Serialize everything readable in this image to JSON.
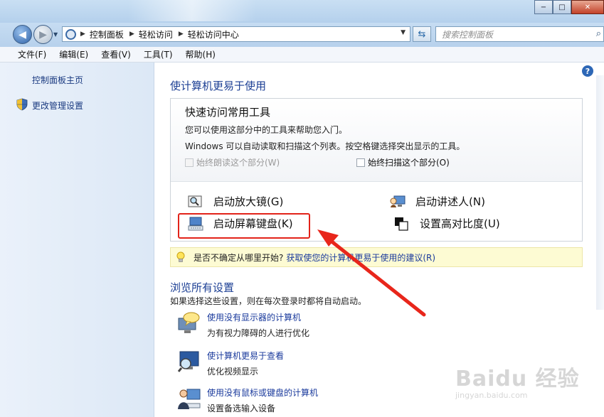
{
  "window": {
    "minimize": "−",
    "maximize": "□",
    "close": "✕"
  },
  "address": {
    "crumbs": [
      "控制面板",
      "轻松访问",
      "轻松访问中心"
    ],
    "search_placeholder": "搜索控制面板"
  },
  "menu": [
    "文件(F)",
    "编辑(E)",
    "查看(V)",
    "工具(T)",
    "帮助(H)"
  ],
  "sidebar": {
    "home": "控制面板主页",
    "admin": "更改管理设置"
  },
  "main": {
    "heading": "使计算机更易于使用",
    "quick": {
      "title": "快速访问常用工具",
      "desc1": "您可以使用这部分中的工具来帮助您入门。",
      "desc2": "Windows 可以自动读取和扫描这个列表。按空格键选择突出显示的工具。",
      "cb_read": "始终朗读这个部分(W)",
      "cb_scan": "始终扫描这个部分(O)",
      "tools": {
        "magnifier": "启动放大镜(G)",
        "narrator": "启动讲述人(N)",
        "osk": "启动屏幕键盘(K)",
        "contrast": "设置高对比度(U)"
      }
    },
    "hint": {
      "question": "是否不确定从哪里开始?",
      "link": "获取使您的计算机更易于使用的建议(R)"
    },
    "browse": {
      "heading": "浏览所有设置",
      "desc": "如果选择这些设置，则在每次登录时都将自动启动。",
      "items": [
        {
          "title": "使用没有显示器的计算机",
          "sub": "为有视力障碍的人进行优化"
        },
        {
          "title": "使计算机更易于查看",
          "sub": "优化视频显示"
        },
        {
          "title": "使用没有鼠标或键盘的计算机",
          "sub": "设置备选输入设备"
        }
      ]
    }
  },
  "watermark": {
    "brand": "Baidu 经验",
    "url": "jingyan.baidu.com"
  },
  "colors": {
    "link": "#1a3a9c",
    "heading": "#1c3f94",
    "highlight": "#e2231a",
    "hint_bg": "#fdfbd3"
  }
}
